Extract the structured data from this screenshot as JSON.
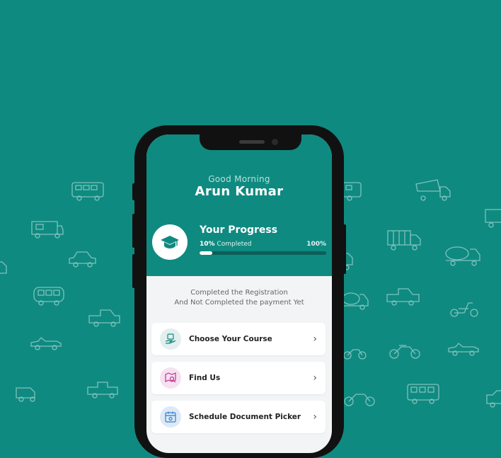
{
  "header": {
    "greeting": "Good Morning",
    "user_name": "Arun Kumar"
  },
  "progress": {
    "title": "Your Progress",
    "percent_label": "10%",
    "completed_label": "Completed",
    "max_label": "100%",
    "value": 0.1
  },
  "status": {
    "line1": "Completed the Registration",
    "line2": "And Not Completed the payment Yet"
  },
  "menu": [
    {
      "label": "Choose Your Course",
      "icon": "hand-book-icon",
      "icon_bg": "#e3efee"
    },
    {
      "label": "Find Us",
      "icon": "map-search-icon",
      "icon_bg": "#f6e1f0"
    },
    {
      "label": "Schedule Document Picker",
      "icon": "calendar-icon",
      "icon_bg": "#dde9f6"
    }
  ],
  "colors": {
    "brand": "#0f8a80",
    "screen_bg": "#f2f4f5"
  }
}
